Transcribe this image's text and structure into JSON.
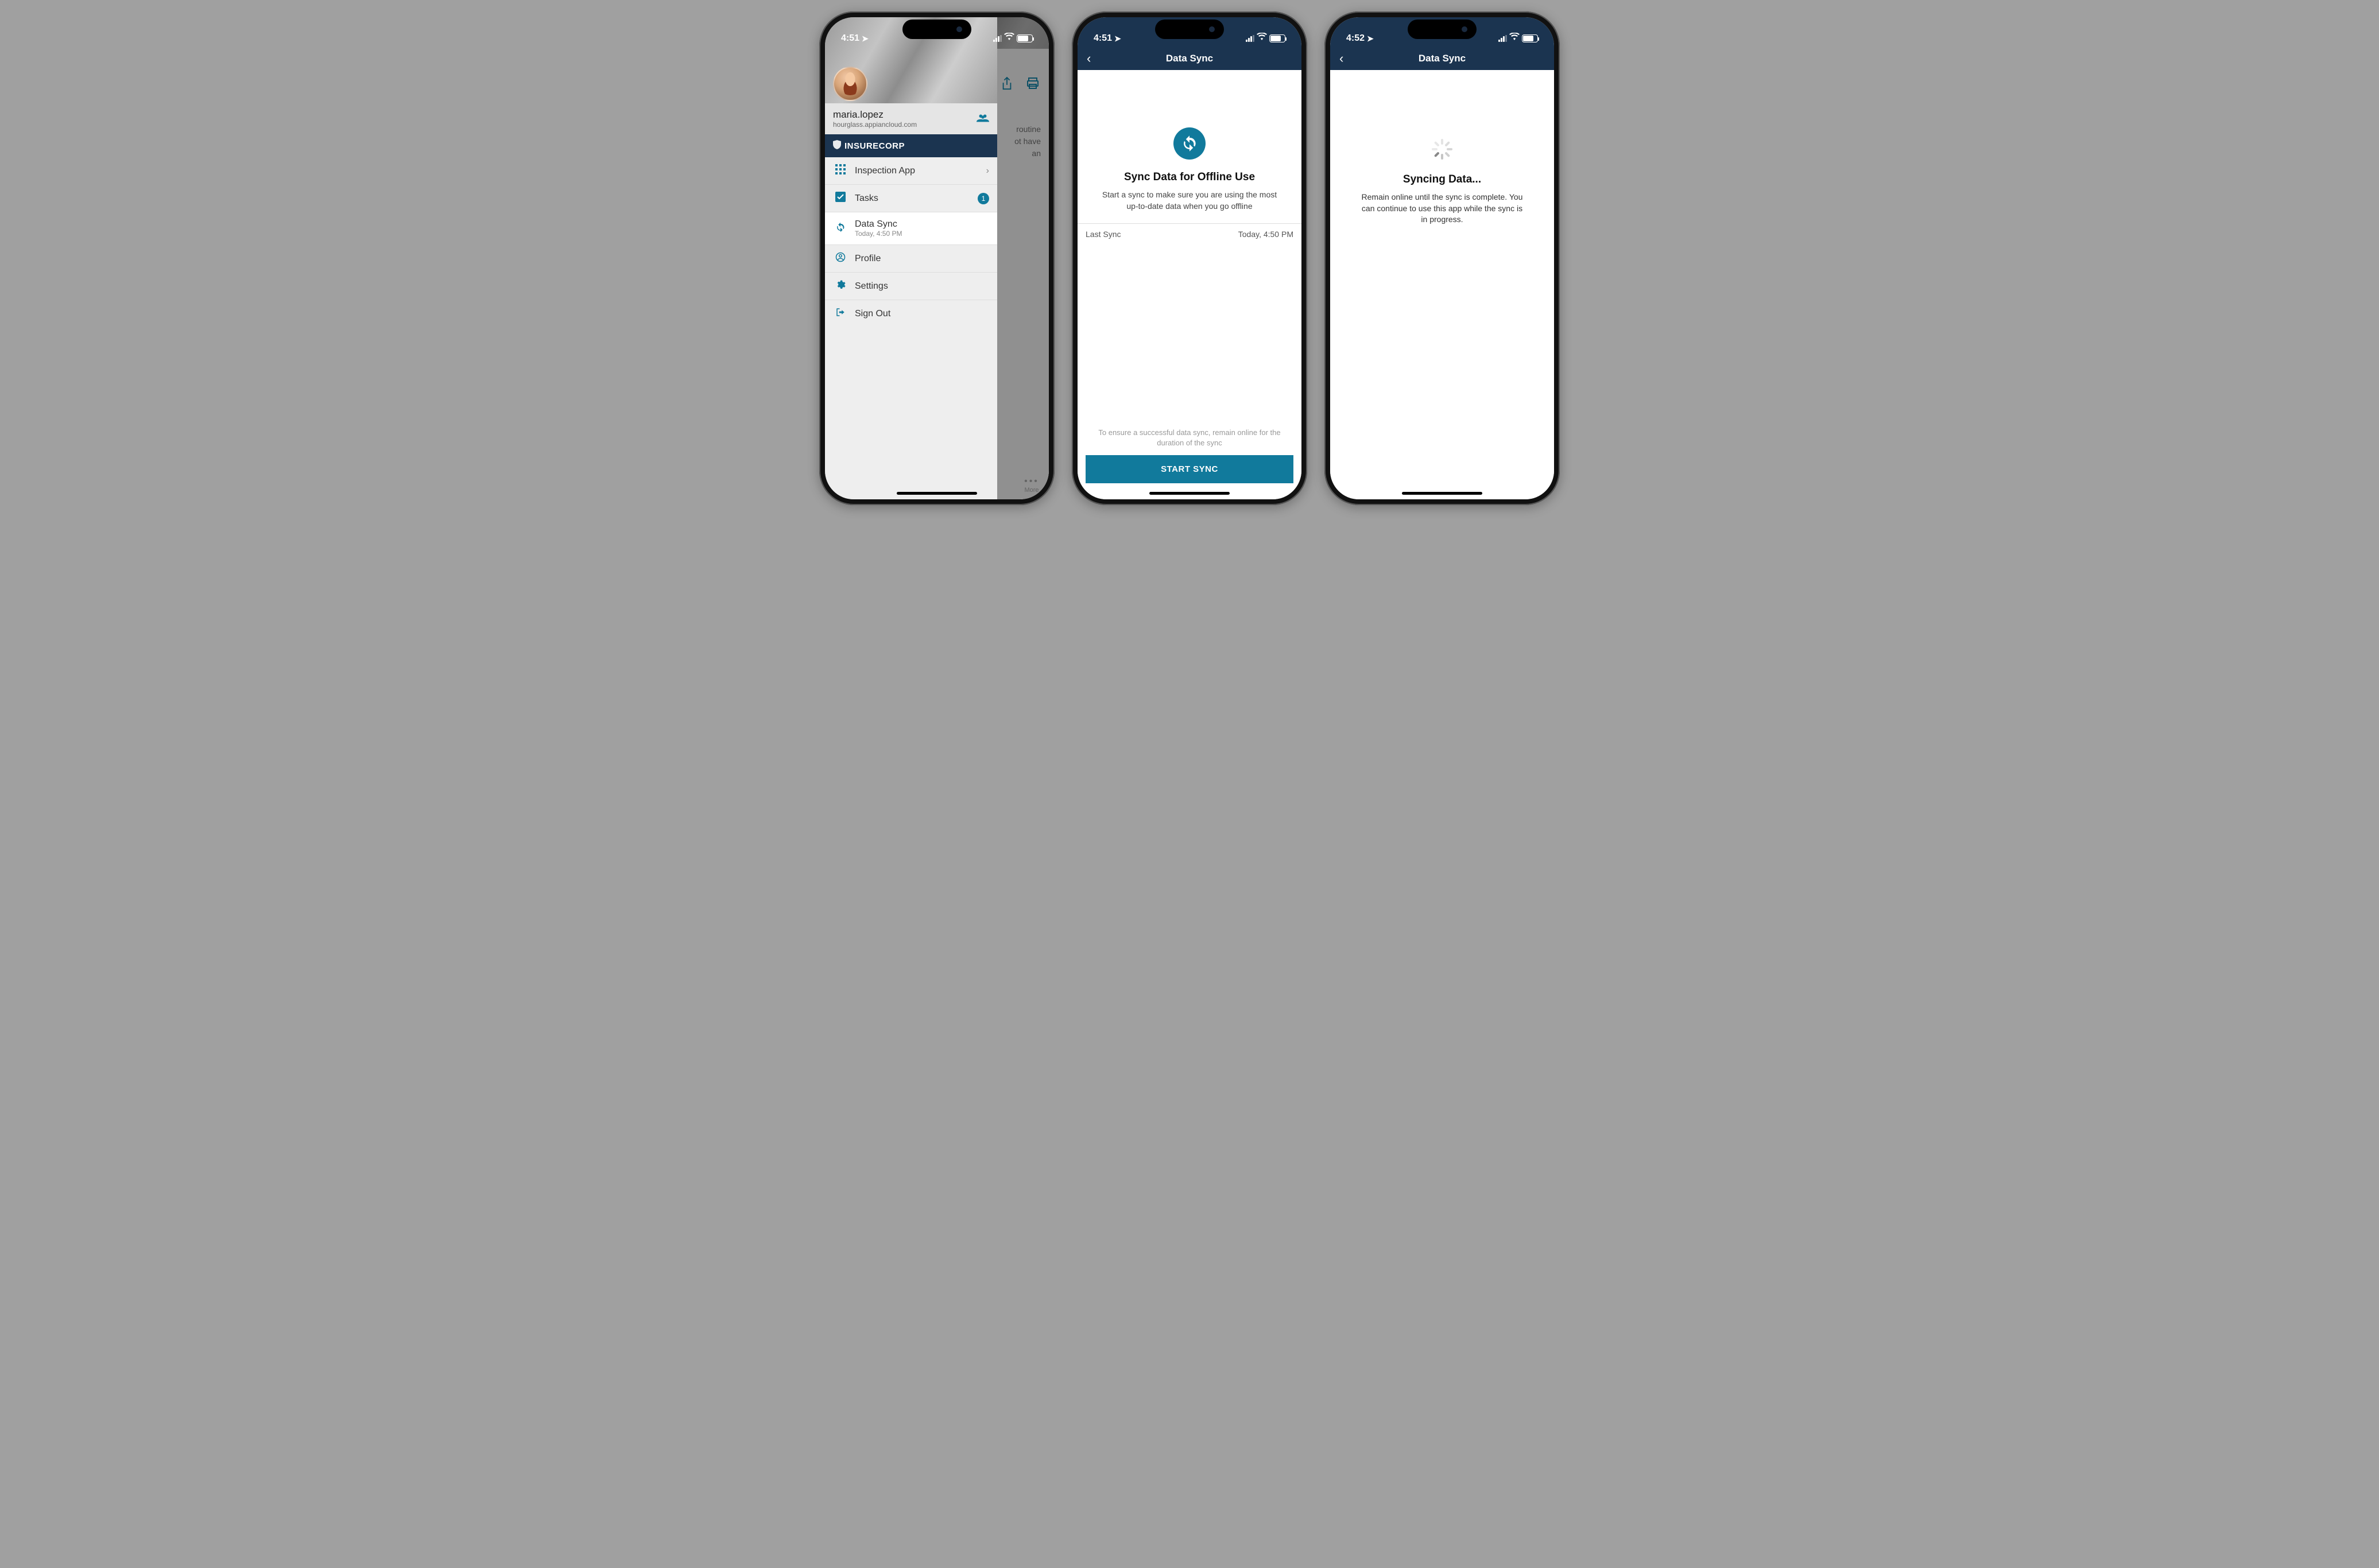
{
  "phones": {
    "p1": {
      "status": {
        "time": "4:51",
        "battery": "77"
      },
      "user": {
        "name": "maria.lopez",
        "host": "hourglass.appiancloud.com"
      },
      "brand": "INSURECORP",
      "menu": {
        "inspection": "Inspection App",
        "tasks": "Tasks",
        "tasks_badge": "1",
        "datasync": "Data Sync",
        "datasync_sub": "Today, 4:50 PM",
        "profile": "Profile",
        "settings": "Settings",
        "signout": "Sign Out"
      },
      "obscured": {
        "line1": "routine",
        "line2": "ot have an"
      },
      "more_label": "More"
    },
    "p2": {
      "status": {
        "time": "4:51",
        "battery": "77"
      },
      "title": "Data Sync",
      "hero": {
        "heading": "Sync Data for Offline Use",
        "desc": "Start a sync to make sure you are using the most up-to-date data when you go offline"
      },
      "row": {
        "label": "Last Sync",
        "value": "Today, 4:50 PM"
      },
      "footer_note": "To ensure a successful data sync, remain online for the duration of the sync",
      "button": "START SYNC"
    },
    "p3": {
      "status": {
        "time": "4:52",
        "battery": "77"
      },
      "title": "Data Sync",
      "syncing": {
        "heading": "Syncing Data...",
        "desc": "Remain online until the sync is complete. You can continue to use this app while the sync is in progress."
      }
    }
  }
}
